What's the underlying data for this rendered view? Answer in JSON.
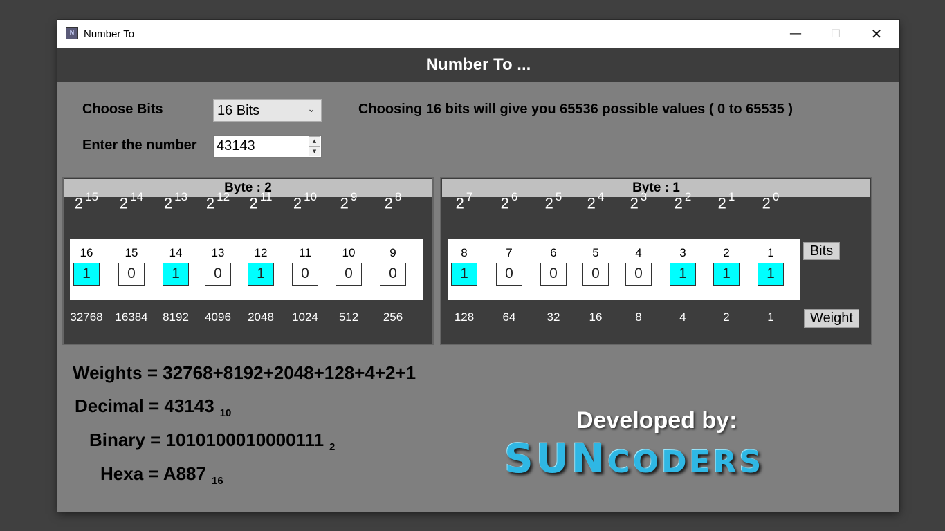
{
  "window": {
    "title": "Number To",
    "icon": "app-icon",
    "min": "—",
    "max": "☐",
    "close": "✕"
  },
  "header": {
    "title": "Number To ..."
  },
  "controls": {
    "choose_bits_label": "Choose Bits",
    "bits_value": "16 Bits",
    "enter_number_label": "Enter the number",
    "number_value": "43143",
    "info_text": "Choosing 16 bits will give you 65536 possible values ( 0 to 65535 )"
  },
  "byte2": {
    "title": "Byte : 2",
    "powers": [
      "15",
      "14",
      "13",
      "12",
      "11",
      "10",
      "9",
      "8"
    ],
    "indices": [
      "16",
      "15",
      "14",
      "13",
      "12",
      "11",
      "10",
      "9"
    ],
    "bits": [
      "1",
      "0",
      "1",
      "0",
      "1",
      "0",
      "0",
      "0"
    ],
    "weights": [
      "32768",
      "16384",
      "8192",
      "4096",
      "2048",
      "1024",
      "512",
      "256"
    ]
  },
  "byte1": {
    "title": "Byte : 1",
    "powers": [
      "7",
      "6",
      "5",
      "4",
      "3",
      "2",
      "1",
      "0"
    ],
    "indices": [
      "8",
      "7",
      "6",
      "5",
      "4",
      "3",
      "2",
      "1"
    ],
    "bits": [
      "1",
      "0",
      "0",
      "0",
      "0",
      "1",
      "1",
      "1"
    ],
    "weights": [
      "128",
      "64",
      "32",
      "16",
      "8",
      "4",
      "2",
      "1"
    ]
  },
  "labels": {
    "base": "2",
    "bits_btn": "Bits",
    "weight_btn": "Weight"
  },
  "results": {
    "weights": "Weights = 32768+8192+2048+128+4+2+1",
    "decimal": "Decimal = 43143",
    "decimal_base": "10",
    "binary": "Binary = 1010100010000111",
    "binary_base": "2",
    "hexa": "Hexa = A887",
    "hexa_base": "16"
  },
  "credits": {
    "developed_by": "Developed by:",
    "brand_big": "SUN",
    "brand_small": "CODERS"
  },
  "colors": {
    "bit_on": "#00ffff",
    "panel": "#3d3d3d",
    "window_bg": "#7f7f7f"
  }
}
